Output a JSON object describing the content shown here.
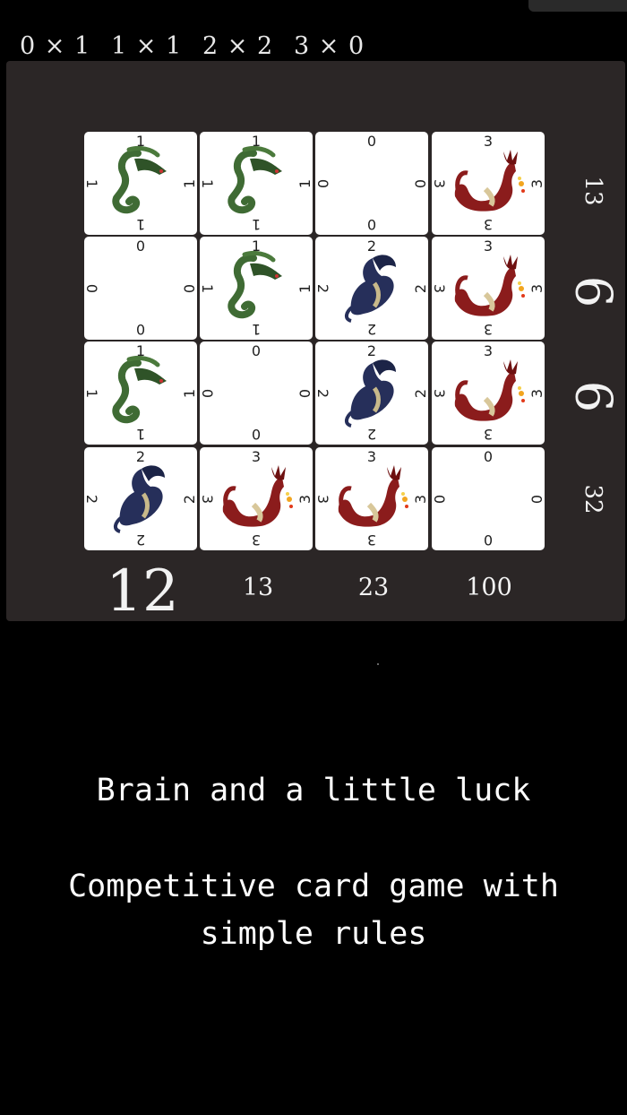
{
  "multipliers": [
    "0 × 1",
    "1 × 1",
    "2 × 2",
    "3 × 0"
  ],
  "cards": [
    {
      "value": "1",
      "art": "green-dragon"
    },
    {
      "value": "1",
      "art": "green-dragon"
    },
    {
      "value": "0",
      "art": "empty"
    },
    {
      "value": "3",
      "art": "red-dragon"
    },
    {
      "value": "0",
      "art": "empty"
    },
    {
      "value": "1",
      "art": "green-dragon"
    },
    {
      "value": "2",
      "art": "blue-dragon"
    },
    {
      "value": "3",
      "art": "red-dragon"
    },
    {
      "value": "1",
      "art": "green-dragon"
    },
    {
      "value": "0",
      "art": "empty"
    },
    {
      "value": "2",
      "art": "blue-dragon"
    },
    {
      "value": "3",
      "art": "red-dragon"
    },
    {
      "value": "2",
      "art": "blue-dragon"
    },
    {
      "value": "3",
      "art": "red-dragon"
    },
    {
      "value": "3",
      "art": "red-dragon"
    },
    {
      "value": "0",
      "art": "empty"
    }
  ],
  "row_scores": [
    "13",
    "6",
    "6",
    "32"
  ],
  "col_scores": [
    "12",
    "13",
    "23",
    "100"
  ],
  "tagline": {
    "line1": "Brain and a little luck",
    "line2": "Competitive card game with",
    "line3": "simple rules"
  },
  "colors": {
    "board": "#2b2626",
    "green_dragon": "#3f6b34",
    "blue_dragon": "#262f5a",
    "red_dragon": "#8b1c1c"
  }
}
